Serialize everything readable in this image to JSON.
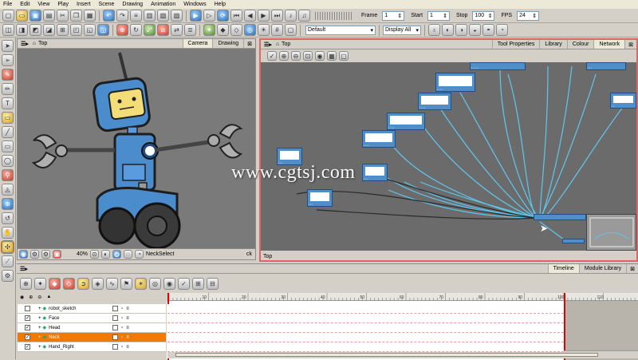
{
  "menu": [
    "File",
    "Edit",
    "View",
    "Play",
    "Insert",
    "Scene",
    "Drawing",
    "Animation",
    "Windows",
    "Help"
  ],
  "playback": {
    "frame_label": "Frame",
    "frame_value": "1",
    "start_label": "Start",
    "start_value": "1",
    "stop_label": "Stop",
    "stop_value": "100",
    "fps_label": "FPS",
    "fps_value": "24"
  },
  "toolbar2": {
    "palette_select": "Default",
    "display_select": "Display All"
  },
  "camera_view": {
    "title": "Top",
    "tabs": [
      "Camera",
      "Drawing"
    ],
    "zoom": "40%",
    "status_text": "NeckSelect",
    "status_right": "ck"
  },
  "network_view": {
    "title": "Top",
    "tabs": [
      "Tool Properties",
      "Library",
      "Colour",
      "Network"
    ],
    "footer": "Top"
  },
  "watermark": "www.cgtsj.com",
  "timeline": {
    "tabs": [
      "Timeline",
      "Module Library"
    ],
    "layers": [
      "robot_sketch",
      "Face",
      "Head",
      "Neck",
      "Hand_Right"
    ],
    "selected_layer": "Neck",
    "checked": [
      false,
      true,
      true,
      true,
      true
    ],
    "frame_ticks": [
      "10",
      "20",
      "30",
      "40",
      "50",
      "60",
      "70",
      "80",
      "90",
      "100",
      "110"
    ]
  },
  "colors": {
    "accent_selected": "#f07a00",
    "network_bg": "#6b6b6b",
    "node_fill": "#4f8ec9",
    "link": "#5fc7f0",
    "camera_bg": "#7a7a7a"
  }
}
